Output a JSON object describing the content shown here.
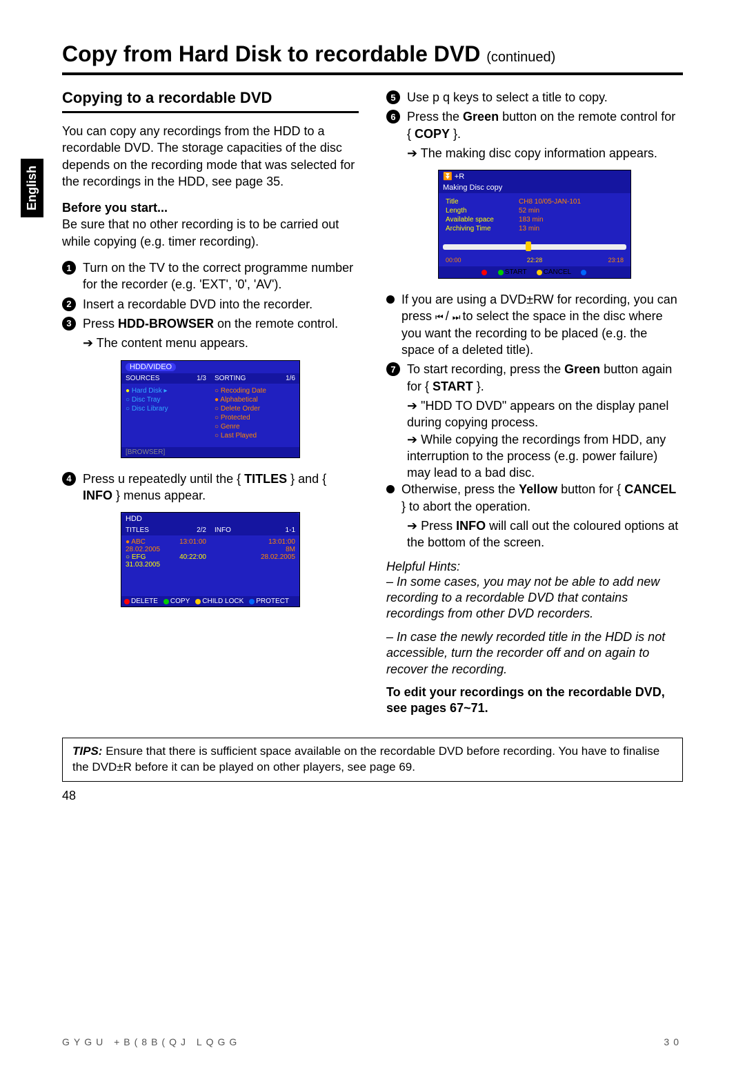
{
  "language_tab": "English",
  "title_main": "Copy from Hard Disk to recordable DVD",
  "title_cont": "(continued)",
  "section": "Copying to a recordable DVD",
  "intro": "You can copy any recordings from the HDD to a recordable DVD. The storage capacities of the disc depends on the recording mode that was selected for the recordings in the HDD, see page 35.",
  "before_start_label": "Before you start...",
  "before_start": "Be sure that no other recording is to be carried out while copying (e.g. timer recording).",
  "step1": "Turn on the TV to the correct programme number for the recorder (e.g. 'EXT', '0', 'AV').",
  "step2": "Insert a recordable DVD into the recorder.",
  "step3_a": "Press ",
  "step3_b": "HDD-BROWSER",
  "step3_c": " on the remote control.",
  "step3_res": "The content menu appears.",
  "step4_a": "Press u repeatedly until the { ",
  "step4_b": "TITLES",
  "step4_c": " } and { ",
  "step4_d": "INFO",
  "step4_e": " } menus appear.",
  "step5": "Use p q keys to select a title to copy.",
  "step6_a": "Press the ",
  "step6_b": "Green",
  "step6_c": " button on the remote control for { ",
  "step6_d": "COPY",
  "step6_e": " }.",
  "step6_res": "The making disc copy information appears.",
  "bullet_rw_a": "If you are using a DVD±RW for recording, you can press ",
  "bullet_rw_b": " to select the space in the disc where you want the recording to be placed (e.g. the space of a deleted title).",
  "step7_a": "To start recording, press the ",
  "step7_b": "Green",
  "step7_c": " button again for { ",
  "step7_d": "START",
  "step7_e": " }.",
  "step7_res1": "\"HDD TO DVD\" appears on the display panel during copying process.",
  "step7_res2": "While copying the recordings from HDD, any interruption to the process (e.g. power failure) may lead to a bad disc.",
  "bullet_cancel_a": "Otherwise, press the ",
  "bullet_cancel_b": "Yellow",
  "bullet_cancel_c": " button for { ",
  "bullet_cancel_d": "CANCEL",
  "bullet_cancel_e": " } to abort the operation.",
  "bullet_cancel_res_a": "Press ",
  "bullet_cancel_res_b": "INFO",
  "bullet_cancel_res_c": " will call out the coloured options at the bottom of the screen.",
  "hints_title": "Helpful Hints:",
  "hint1": "– In some cases, you may not be able to add new recording to a recordable DVD that contains recordings from other DVD recorders.",
  "hint2": "– In case the newly recorded title in the HDD is not accessible, turn the recorder off and on again to recover the recording.",
  "crossref": "To edit your recordings on the recordable DVD, see pages 67~71.",
  "tips_lead": "TIPS:",
  "tips_body": "Ensure that there is sufficient space available on the recordable DVD before recording. You have to finalise the DVD±R before it can be played on other players, see page 69.",
  "pagenum": "48",
  "footer_left": "GYGU   +B(8B(QJ   LQGG",
  "footer_right": "30",
  "ui1": {
    "header": "HDD/VIDEO",
    "sources_label": "SOURCES",
    "sources_count": "1/3",
    "sorting_label": "SORTING",
    "sorting_count": "1/6",
    "sources": [
      "Hard Disk",
      "Disc Tray",
      "Disc Library"
    ],
    "sorting": [
      "Recoding Date",
      "Alphabetical",
      "Delete Order",
      "Protected",
      "Genre",
      "Last Played"
    ],
    "bottom": "[BROWSER]"
  },
  "ui2": {
    "header": "HDD",
    "titles_label": "TITLES",
    "titles_count": "2/2",
    "info_label": "INFO",
    "info_count": "1-1",
    "rows": [
      {
        "name": "ABC 28.02.2005",
        "dur": "13:01:00"
      },
      {
        "name": "EFG 31.03.2005",
        "dur": "40:22:00"
      }
    ],
    "info": [
      "13:01:00",
      "8M",
      "28.02.2005"
    ],
    "btns": {
      "delete": "DELETE",
      "copy": "COPY",
      "childlock": "CHILD LOCK",
      "protect": "PROTECT"
    }
  },
  "ui3": {
    "top": "+R",
    "title": "Making Disc copy",
    "rows": [
      {
        "k": "Title",
        "v": "CH8 10/05-JAN-101"
      },
      {
        "k": "Length",
        "v": "52 min"
      },
      {
        "k": "Available space",
        "v": "183 min"
      },
      {
        "k": "Archiving Time",
        "v": "13 min"
      }
    ],
    "progress_left": "00:00",
    "progress_mid": "22:28",
    "progress_right": "23:18",
    "btns": {
      "start": "START",
      "cancel": "CANCEL"
    }
  }
}
